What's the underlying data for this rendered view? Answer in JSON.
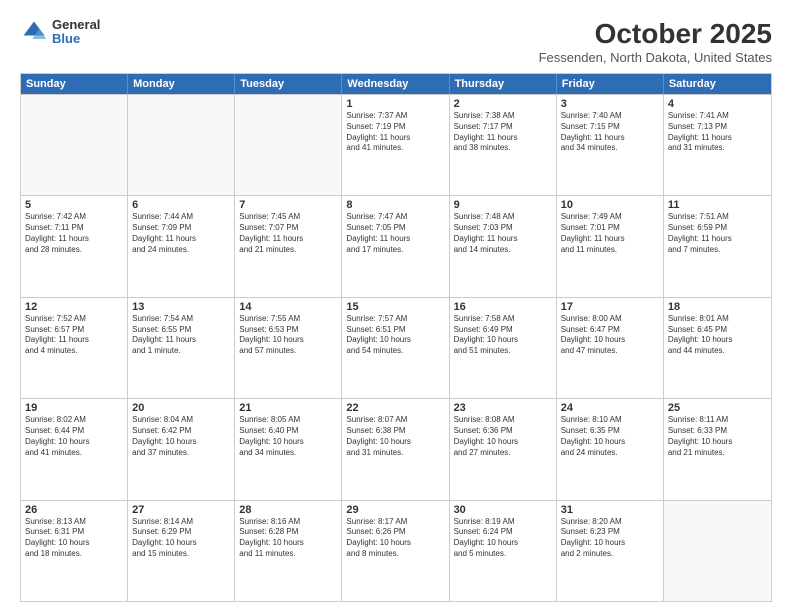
{
  "logo": {
    "general": "General",
    "blue": "Blue"
  },
  "header": {
    "month": "October 2025",
    "location": "Fessenden, North Dakota, United States"
  },
  "weekdays": [
    "Sunday",
    "Monday",
    "Tuesday",
    "Wednesday",
    "Thursday",
    "Friday",
    "Saturday"
  ],
  "rows": [
    [
      {
        "day": "",
        "info": ""
      },
      {
        "day": "",
        "info": ""
      },
      {
        "day": "",
        "info": ""
      },
      {
        "day": "1",
        "info": "Sunrise: 7:37 AM\nSunset: 7:19 PM\nDaylight: 11 hours\nand 41 minutes."
      },
      {
        "day": "2",
        "info": "Sunrise: 7:38 AM\nSunset: 7:17 PM\nDaylight: 11 hours\nand 38 minutes."
      },
      {
        "day": "3",
        "info": "Sunrise: 7:40 AM\nSunset: 7:15 PM\nDaylight: 11 hours\nand 34 minutes."
      },
      {
        "day": "4",
        "info": "Sunrise: 7:41 AM\nSunset: 7:13 PM\nDaylight: 11 hours\nand 31 minutes."
      }
    ],
    [
      {
        "day": "5",
        "info": "Sunrise: 7:42 AM\nSunset: 7:11 PM\nDaylight: 11 hours\nand 28 minutes."
      },
      {
        "day": "6",
        "info": "Sunrise: 7:44 AM\nSunset: 7:09 PM\nDaylight: 11 hours\nand 24 minutes."
      },
      {
        "day": "7",
        "info": "Sunrise: 7:45 AM\nSunset: 7:07 PM\nDaylight: 11 hours\nand 21 minutes."
      },
      {
        "day": "8",
        "info": "Sunrise: 7:47 AM\nSunset: 7:05 PM\nDaylight: 11 hours\nand 17 minutes."
      },
      {
        "day": "9",
        "info": "Sunrise: 7:48 AM\nSunset: 7:03 PM\nDaylight: 11 hours\nand 14 minutes."
      },
      {
        "day": "10",
        "info": "Sunrise: 7:49 AM\nSunset: 7:01 PM\nDaylight: 11 hours\nand 11 minutes."
      },
      {
        "day": "11",
        "info": "Sunrise: 7:51 AM\nSunset: 6:59 PM\nDaylight: 11 hours\nand 7 minutes."
      }
    ],
    [
      {
        "day": "12",
        "info": "Sunrise: 7:52 AM\nSunset: 6:57 PM\nDaylight: 11 hours\nand 4 minutes."
      },
      {
        "day": "13",
        "info": "Sunrise: 7:54 AM\nSunset: 6:55 PM\nDaylight: 11 hours\nand 1 minute."
      },
      {
        "day": "14",
        "info": "Sunrise: 7:55 AM\nSunset: 6:53 PM\nDaylight: 10 hours\nand 57 minutes."
      },
      {
        "day": "15",
        "info": "Sunrise: 7:57 AM\nSunset: 6:51 PM\nDaylight: 10 hours\nand 54 minutes."
      },
      {
        "day": "16",
        "info": "Sunrise: 7:58 AM\nSunset: 6:49 PM\nDaylight: 10 hours\nand 51 minutes."
      },
      {
        "day": "17",
        "info": "Sunrise: 8:00 AM\nSunset: 6:47 PM\nDaylight: 10 hours\nand 47 minutes."
      },
      {
        "day": "18",
        "info": "Sunrise: 8:01 AM\nSunset: 6:45 PM\nDaylight: 10 hours\nand 44 minutes."
      }
    ],
    [
      {
        "day": "19",
        "info": "Sunrise: 8:02 AM\nSunset: 6:44 PM\nDaylight: 10 hours\nand 41 minutes."
      },
      {
        "day": "20",
        "info": "Sunrise: 8:04 AM\nSunset: 6:42 PM\nDaylight: 10 hours\nand 37 minutes."
      },
      {
        "day": "21",
        "info": "Sunrise: 8:05 AM\nSunset: 6:40 PM\nDaylight: 10 hours\nand 34 minutes."
      },
      {
        "day": "22",
        "info": "Sunrise: 8:07 AM\nSunset: 6:38 PM\nDaylight: 10 hours\nand 31 minutes."
      },
      {
        "day": "23",
        "info": "Sunrise: 8:08 AM\nSunset: 6:36 PM\nDaylight: 10 hours\nand 27 minutes."
      },
      {
        "day": "24",
        "info": "Sunrise: 8:10 AM\nSunset: 6:35 PM\nDaylight: 10 hours\nand 24 minutes."
      },
      {
        "day": "25",
        "info": "Sunrise: 8:11 AM\nSunset: 6:33 PM\nDaylight: 10 hours\nand 21 minutes."
      }
    ],
    [
      {
        "day": "26",
        "info": "Sunrise: 8:13 AM\nSunset: 6:31 PM\nDaylight: 10 hours\nand 18 minutes."
      },
      {
        "day": "27",
        "info": "Sunrise: 8:14 AM\nSunset: 6:29 PM\nDaylight: 10 hours\nand 15 minutes."
      },
      {
        "day": "28",
        "info": "Sunrise: 8:16 AM\nSunset: 6:28 PM\nDaylight: 10 hours\nand 11 minutes."
      },
      {
        "day": "29",
        "info": "Sunrise: 8:17 AM\nSunset: 6:26 PM\nDaylight: 10 hours\nand 8 minutes."
      },
      {
        "day": "30",
        "info": "Sunrise: 8:19 AM\nSunset: 6:24 PM\nDaylight: 10 hours\nand 5 minutes."
      },
      {
        "day": "31",
        "info": "Sunrise: 8:20 AM\nSunset: 6:23 PM\nDaylight: 10 hours\nand 2 minutes."
      },
      {
        "day": "",
        "info": ""
      }
    ]
  ]
}
